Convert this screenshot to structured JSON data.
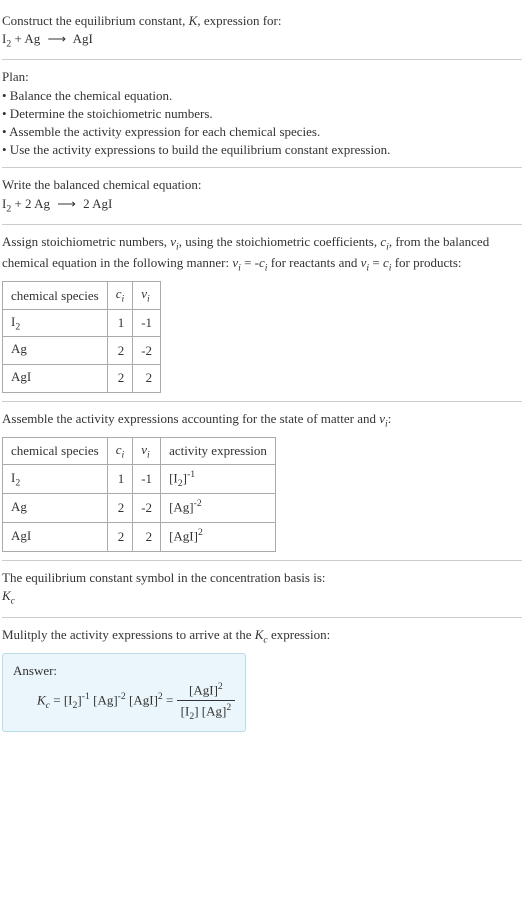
{
  "heading": {
    "intro": "Construct the equilibrium constant, ",
    "Ksym": "K",
    "after": ", expression for:",
    "eq_lhs_i2": "I",
    "eq_lhs_i2_sub": "2",
    "eq_lhs_plus": " + Ag ",
    "eq_arrow": "⟶",
    "eq_rhs": " AgI"
  },
  "plan": {
    "title": "Plan:",
    "b1": "• Balance the chemical equation.",
    "b2": "• Determine the stoichiometric numbers.",
    "b3": "• Assemble the activity expression for each chemical species.",
    "b4": "• Use the activity expressions to build the equilibrium constant expression."
  },
  "balanced": {
    "intro": "Write the balanced chemical equation:",
    "lhs_i2": "I",
    "lhs_i2_sub": "2",
    "lhs_rest": " + 2 Ag ",
    "arrow": "⟶",
    "rhs": " 2 AgI"
  },
  "stoich": {
    "intro_a": "Assign stoichiometric numbers, ",
    "nu": "ν",
    "nu_sub": "i",
    "intro_b": ", using the stoichiometric coefficients, ",
    "c": "c",
    "c_sub": "i",
    "intro_c": ", from the balanced chemical equation in the following manner: ",
    "rel1_a": "ν",
    "rel1_sub": "i",
    "rel1_eq": " = -",
    "rel1_c": "c",
    "rel1_csub": "i",
    "rel1_after": " for reactants and ",
    "rel2_a": "ν",
    "rel2_sub": "i",
    "rel2_eq": " = ",
    "rel2_c": "c",
    "rel2_csub": "i",
    "rel2_after": " for products:",
    "th_species": "chemical species",
    "th_c": "c",
    "th_c_sub": "i",
    "th_nu": "ν",
    "th_nu_sub": "i",
    "rows": [
      {
        "sp_a": "I",
        "sp_sub": "2",
        "c": "1",
        "nu": "-1"
      },
      {
        "sp_a": "Ag",
        "sp_sub": "",
        "c": "2",
        "nu": "-2"
      },
      {
        "sp_a": "AgI",
        "sp_sub": "",
        "c": "2",
        "nu": "2"
      }
    ]
  },
  "activity": {
    "intro_a": "Assemble the activity expressions accounting for the state of matter and ",
    "nu": "ν",
    "nu_sub": "i",
    "intro_b": ":",
    "th_species": "chemical species",
    "th_c": "c",
    "th_c_sub": "i",
    "th_nu": "ν",
    "th_nu_sub": "i",
    "th_act": "activity expression",
    "rows": [
      {
        "sp_a": "I",
        "sp_sub": "2",
        "c": "1",
        "nu": "-1",
        "act_base_a": "[I",
        "act_base_sub": "2",
        "act_base_b": "]",
        "act_exp": "-1"
      },
      {
        "sp_a": "Ag",
        "sp_sub": "",
        "c": "2",
        "nu": "-2",
        "act_base_a": "[Ag]",
        "act_base_sub": "",
        "act_base_b": "",
        "act_exp": "-2"
      },
      {
        "sp_a": "AgI",
        "sp_sub": "",
        "c": "2",
        "nu": "2",
        "act_base_a": "[AgI]",
        "act_base_sub": "",
        "act_base_b": "",
        "act_exp": "2"
      }
    ]
  },
  "symbol": {
    "intro": "The equilibrium constant symbol in the concentration basis is:",
    "K": "K",
    "Ksub": "c"
  },
  "multiply": {
    "intro_a": "Mulitply the activity expressions to arrive at the ",
    "K": "K",
    "Ksub": "c",
    "intro_b": " expression:"
  },
  "answer": {
    "label": "Answer:",
    "K": "K",
    "Ksub": "c",
    "eq": " = ",
    "t1_a": "[I",
    "t1_sub": "2",
    "t1_b": "]",
    "t1_exp": "-1",
    "sp1": " ",
    "t2_a": "[Ag]",
    "t2_exp": "-2",
    "sp2": " ",
    "t3_a": "[AgI]",
    "t3_exp": "2",
    "eq2": " = ",
    "num_a": "[AgI]",
    "num_exp": "2",
    "den_a": "[I",
    "den_sub": "2",
    "den_b": "] [Ag]",
    "den_exp": "2"
  }
}
